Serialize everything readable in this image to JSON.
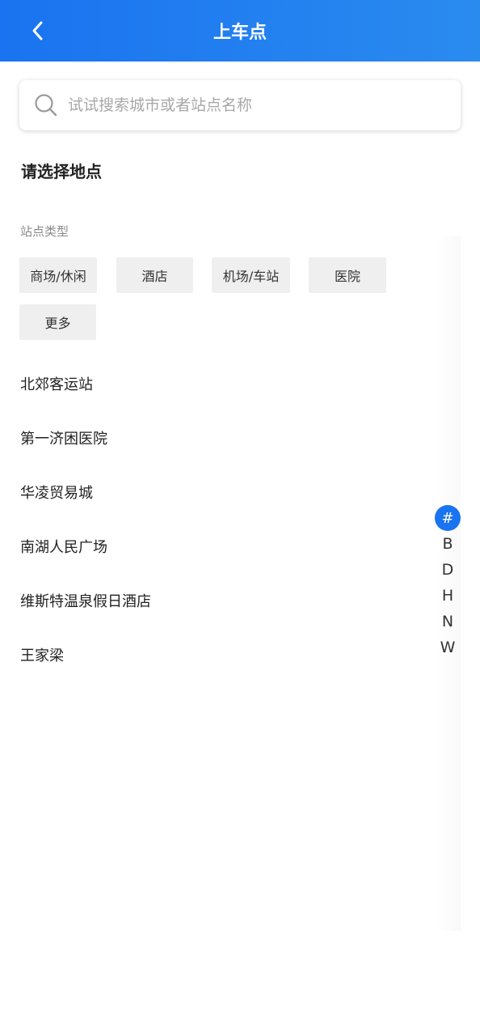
{
  "header": {
    "title": "上车点",
    "back_icon": "chevron-left-icon",
    "background_color": "#1a73f0"
  },
  "search": {
    "placeholder": "试试搜索城市或者站点名称",
    "value": "",
    "icon": "search-icon"
  },
  "section": {
    "title": "请选择地点"
  },
  "station_types": {
    "label": "站点类型",
    "options": [
      "商场/休闲",
      "酒店",
      "机场/车站",
      "医院",
      "更多"
    ]
  },
  "stations": [
    "北郊客运站",
    "第一济困医院",
    "华凌贸易城",
    "南湖人民广场",
    "维斯特温泉假日酒店",
    "王家梁"
  ],
  "index_bar": {
    "letters": [
      "#",
      "B",
      "D",
      "H",
      "N",
      "W"
    ],
    "active": "#",
    "active_color": "#1a73f0"
  }
}
